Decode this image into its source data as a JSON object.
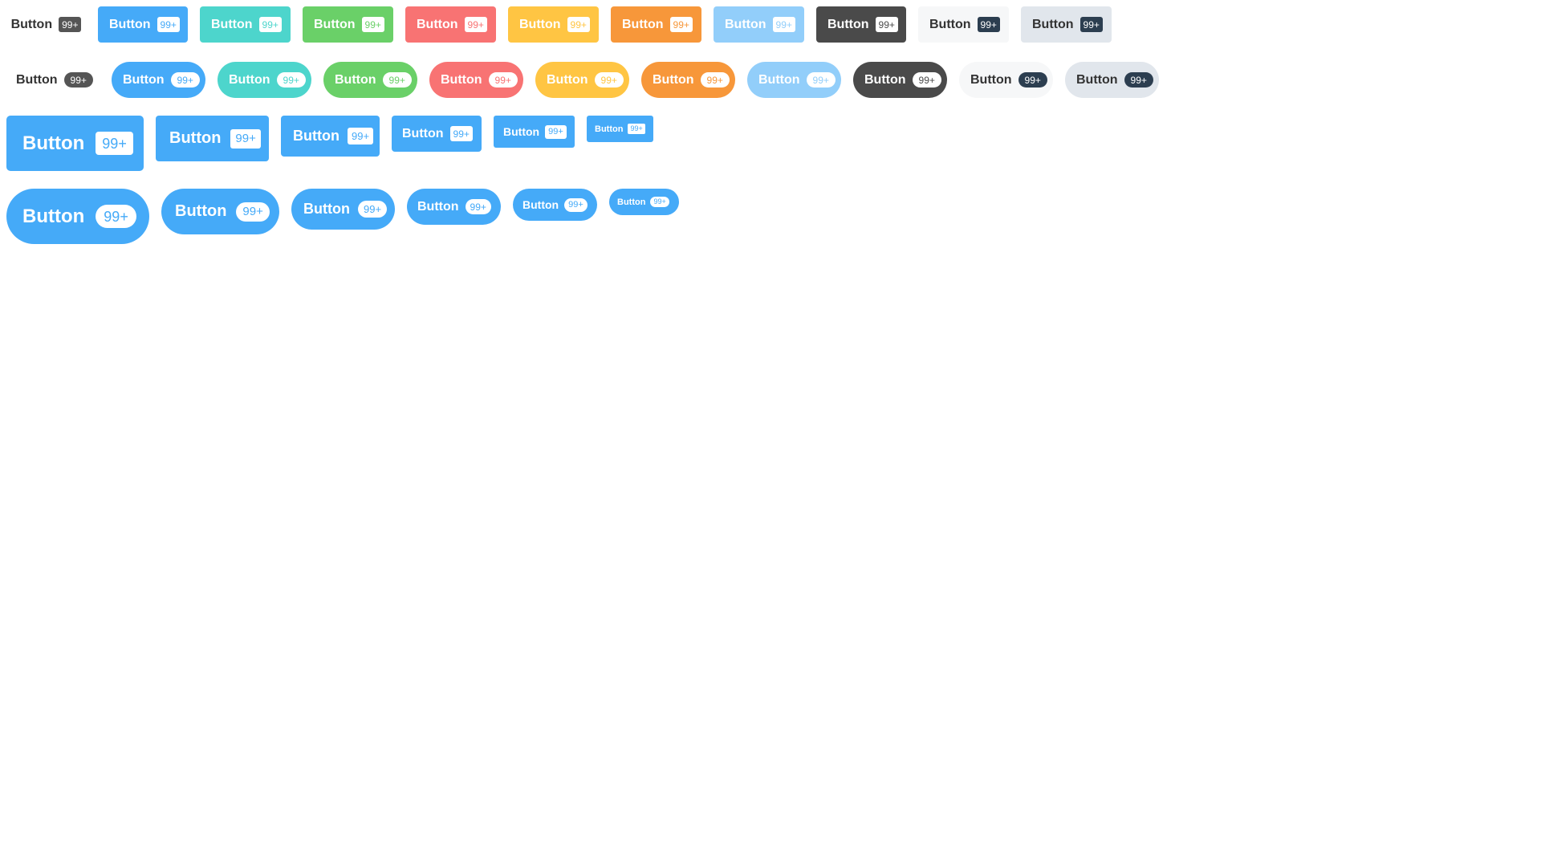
{
  "label": "Button",
  "badge": "99+",
  "colors": {
    "default_text": "#333333",
    "default_badge": "#555555",
    "primary": "#45aaf8",
    "teal": "#4dd5cc",
    "green": "#6ad068",
    "red": "#f87373",
    "yellow": "#ffc543",
    "orange": "#f7973a",
    "light_blue": "#92cefa",
    "dark": "#4a4a4a",
    "white_gray": "#f6f7f8",
    "gray": "#e1e6ec",
    "navy_badge": "#2c3e50"
  },
  "color_variants": [
    "default",
    "primary",
    "teal",
    "green",
    "red",
    "yellow",
    "orange",
    "light-blue",
    "dark",
    "white",
    "gray"
  ],
  "size_variants": [
    "xlarge",
    "large",
    "medium",
    "default",
    "small",
    "xsmall"
  ]
}
